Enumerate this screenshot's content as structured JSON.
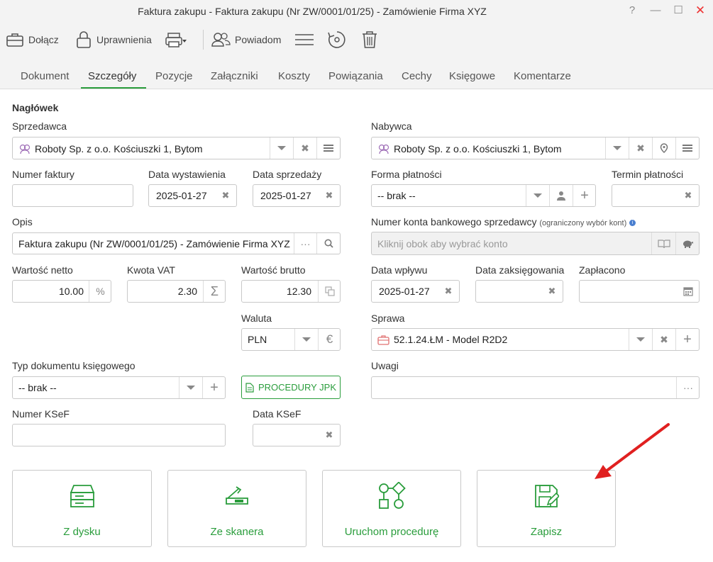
{
  "window": {
    "title": "Faktura zakupu - Faktura zakupu (Nr ZW/0001/01/25) - Zamówienie Firma XYZ",
    "help": "?",
    "minimize": "—",
    "maximize": "☐",
    "close": "✕"
  },
  "toolbar": {
    "attach": "Dołącz",
    "permissions": "Uprawnienia",
    "notify": "Powiadom"
  },
  "tabs": [
    "Dokument",
    "Szczegóły",
    "Pozycje",
    "Załączniki",
    "Koszty",
    "Powiązania",
    "Cechy",
    "Księgowe",
    "Komentarze"
  ],
  "active_tab": "Szczegóły",
  "form": {
    "section": "Nagłówek",
    "seller_label": "Sprzedawca",
    "seller_value": "Roboty Sp. z o.o. Kościuszki 1, Bytom",
    "buyer_label": "Nabywca",
    "buyer_value": "Roboty Sp. z o.o. Kościuszki 1, Bytom",
    "invoice_no_label": "Numer faktury",
    "invoice_no_value": "",
    "issue_date_label": "Data wystawienia",
    "issue_date_value": "2025-01-27",
    "sale_date_label": "Data sprzedaży",
    "sale_date_value": "2025-01-27",
    "payment_form_label": "Forma płatności",
    "payment_form_value": "-- brak --",
    "payment_term_label": "Termin płatności",
    "payment_term_value": "",
    "desc_label": "Opis",
    "desc_value": "Faktura zakupu (Nr ZW/0001/01/25) - Zamówienie Firma XYZ",
    "bank_label": "Numer konta bankowego sprzedawcy",
    "bank_note": "(ograniczony wybór kont)",
    "bank_placeholder": "Kliknij obok aby wybrać konto",
    "net_label": "Wartość netto",
    "net_value": "10.00",
    "net_suffix": "%",
    "vat_label": "Kwota VAT",
    "vat_value": "2.30",
    "vat_suffix": "Σ",
    "gross_label": "Wartość brutto",
    "gross_value": "12.30",
    "receipt_label": "Data wpływu",
    "receipt_value": "2025-01-27",
    "posting_label": "Data zaksięgowania",
    "posting_value": "",
    "paid_label": "Zapłacono",
    "paid_value": "",
    "currency_label": "Waluta",
    "currency_value": "PLN",
    "currency_suffix": "€",
    "case_label": "Sprawa",
    "case_value": "52.1.24.ŁM - Model R2D2",
    "doc_type_label": "Typ dokumentu księgowego",
    "doc_type_value": "-- brak --",
    "jpk_button": "PROCEDURY JPK",
    "notes_label": "Uwagi",
    "notes_value": "",
    "ksef_no_label": "Numer KSeF",
    "ksef_no_value": "",
    "ksef_date_label": "Data KSeF",
    "ksef_date_value": ""
  },
  "actions": {
    "from_disk": "Z dysku",
    "from_scanner": "Ze skanera",
    "run_procedure": "Uruchom procedurę",
    "save": "Zapisz"
  },
  "colors": {
    "accent": "#2a9d3c",
    "arrow": "#e02020"
  }
}
